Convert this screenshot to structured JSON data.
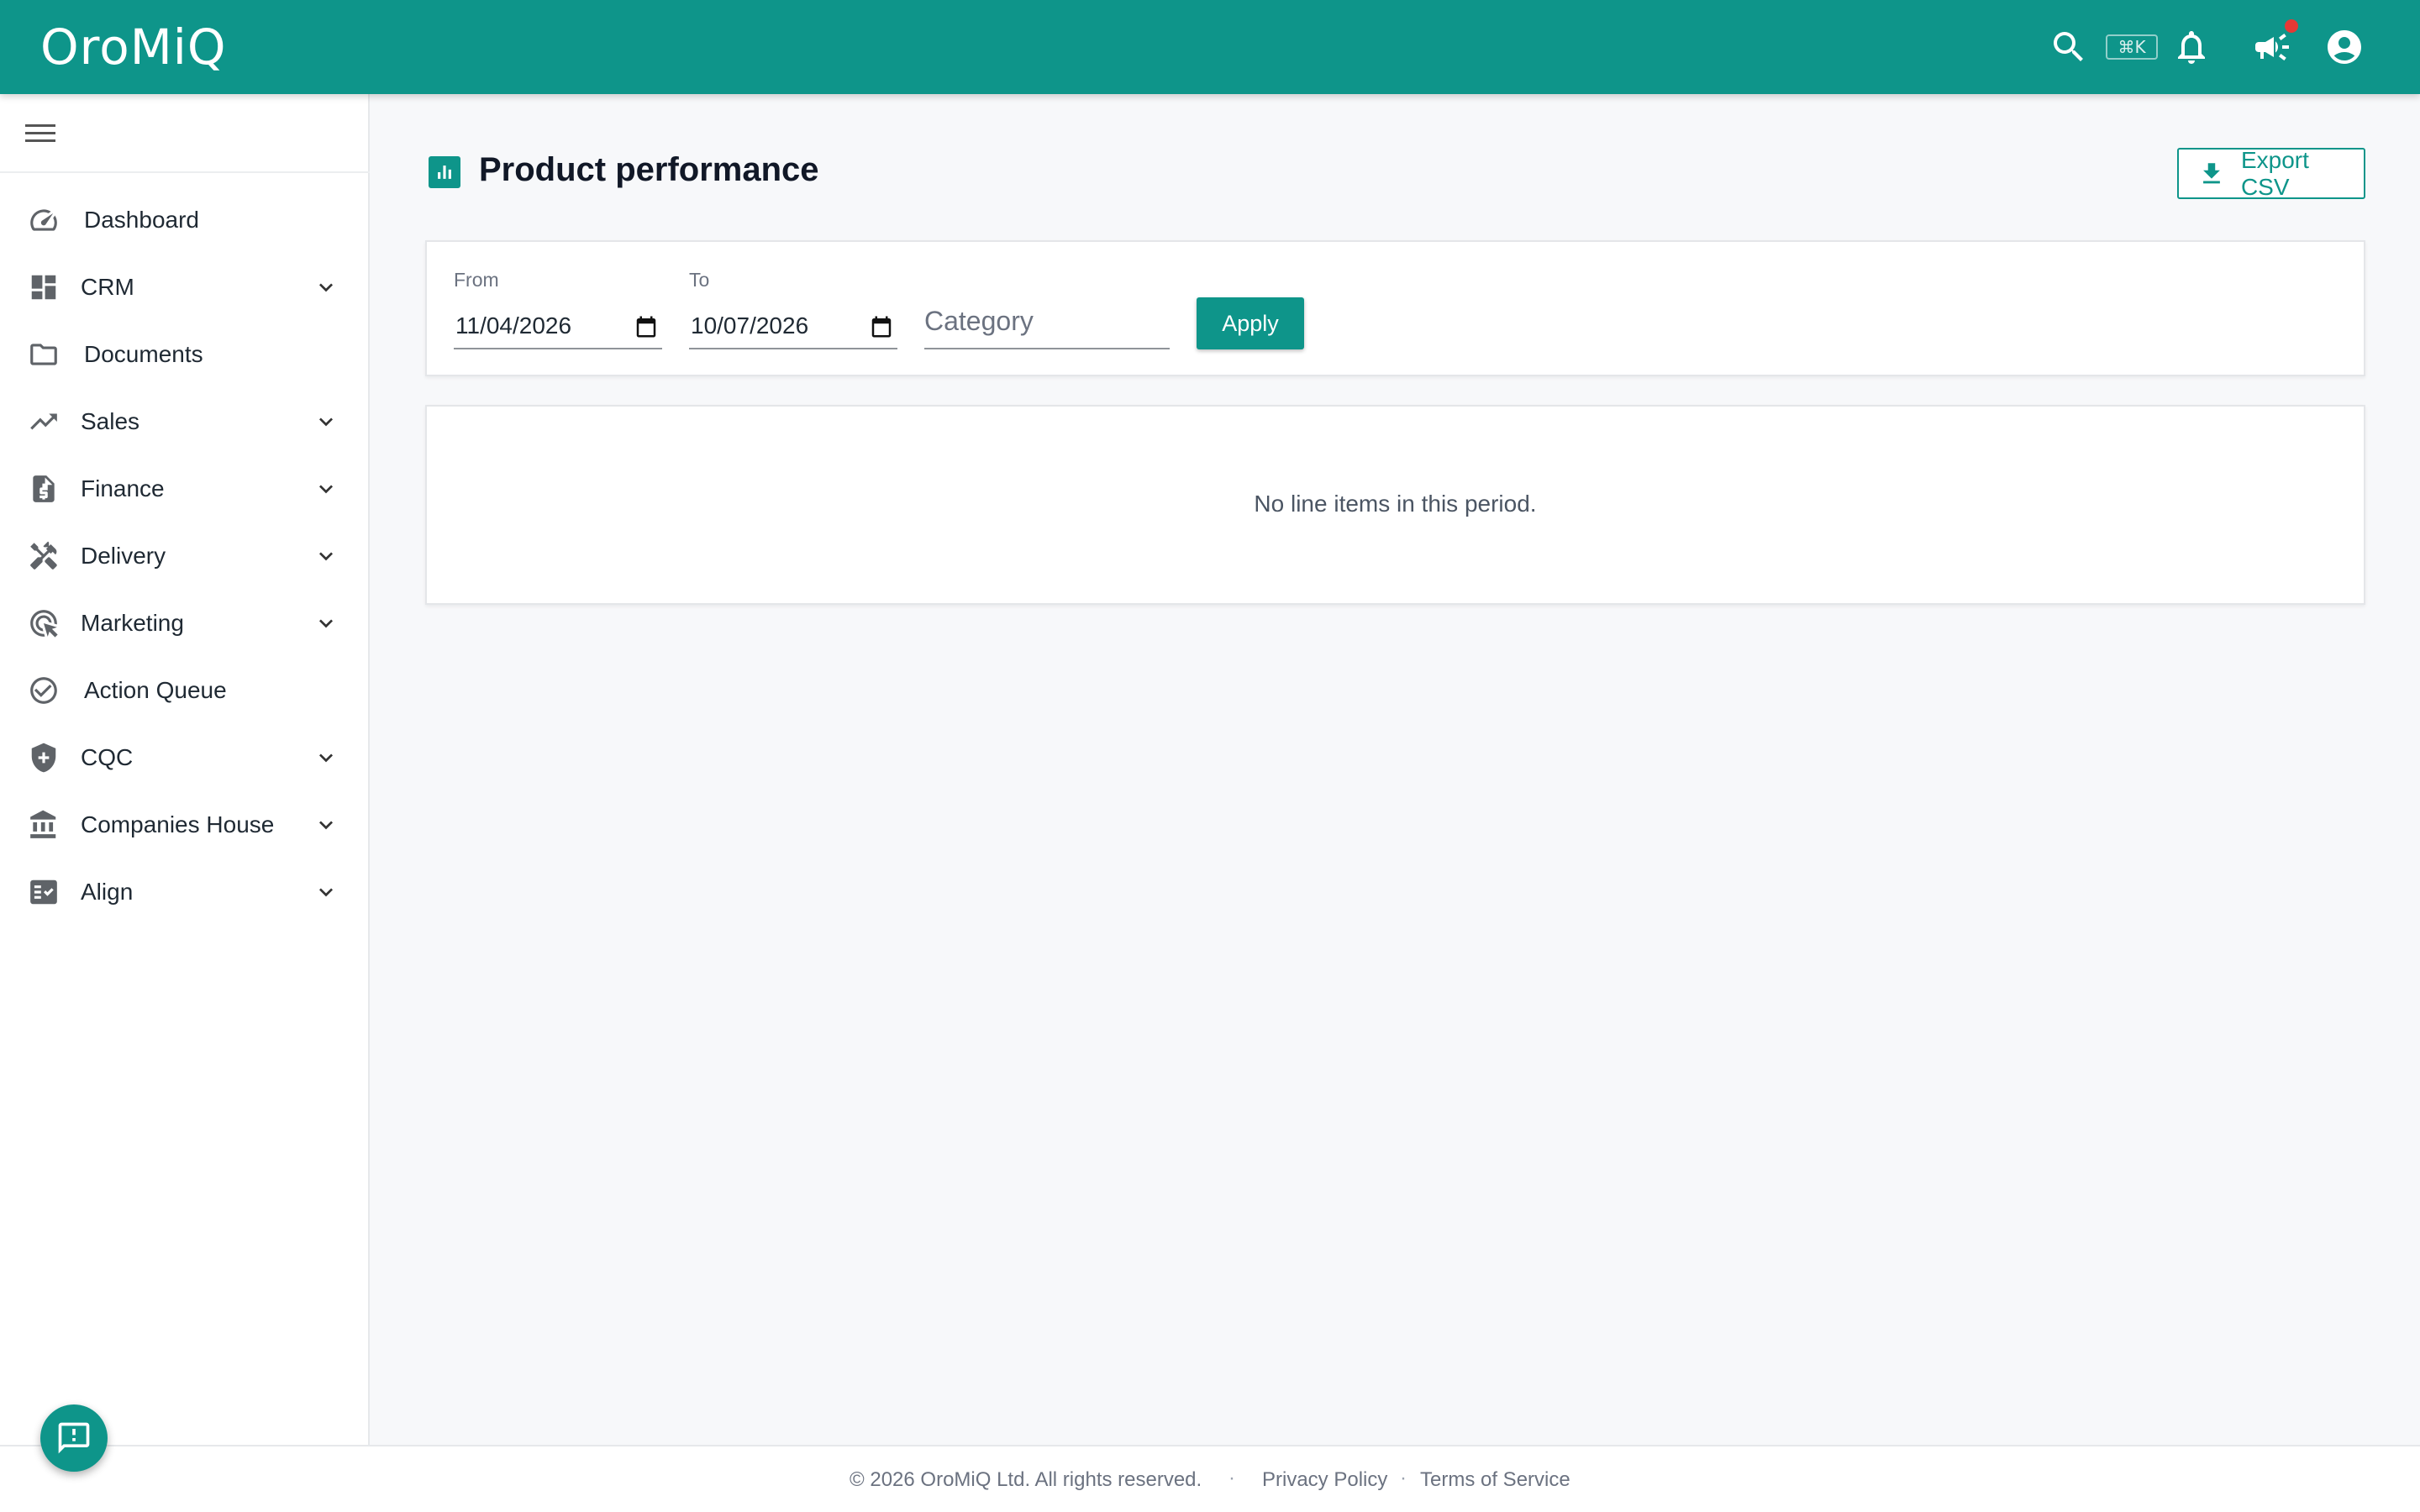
{
  "app": {
    "logo": "OroMiQ"
  },
  "topbar": {
    "shortcut_hint": "⌘K",
    "icons": [
      "search-icon",
      "bell-icon",
      "megaphone-icon",
      "account-icon"
    ]
  },
  "sidebar": {
    "items": [
      {
        "label": "Dashboard",
        "icon": "speedometer-icon",
        "expandable": false
      },
      {
        "label": "CRM",
        "icon": "dashboard-grid-icon",
        "expandable": true
      },
      {
        "label": "Documents",
        "icon": "folder-icon",
        "expandable": false
      },
      {
        "label": "Sales",
        "icon": "trending-up-icon",
        "expandable": true
      },
      {
        "label": "Finance",
        "icon": "invoice-icon",
        "expandable": true
      },
      {
        "label": "Delivery",
        "icon": "tools-icon",
        "expandable": true
      },
      {
        "label": "Marketing",
        "icon": "ads-click-icon",
        "expandable": true
      },
      {
        "label": "Action Queue",
        "icon": "check-circle-icon",
        "expandable": false
      },
      {
        "label": "CQC",
        "icon": "health-shield-icon",
        "expandable": true
      },
      {
        "label": "Companies House",
        "icon": "bank-icon",
        "expandable": true
      },
      {
        "label": "Align",
        "icon": "checklist-icon",
        "expandable": true
      }
    ]
  },
  "main": {
    "title": "Product performance",
    "export_label": "Export CSV",
    "filters": {
      "from_label": "From",
      "from_value": "11/04/2026",
      "to_label": "To",
      "to_value": "10/07/2026",
      "category_placeholder": "Category",
      "apply_label": "Apply"
    },
    "empty_message": "No line items in this period."
  },
  "footer": {
    "copyright": "© 2026 OroMiQ Ltd. All rights reserved.",
    "separator": "·",
    "privacy": "Privacy Policy",
    "terms": "Terms of Service"
  },
  "colors": {
    "brand": "#0e958a",
    "notification": "#e53935"
  }
}
